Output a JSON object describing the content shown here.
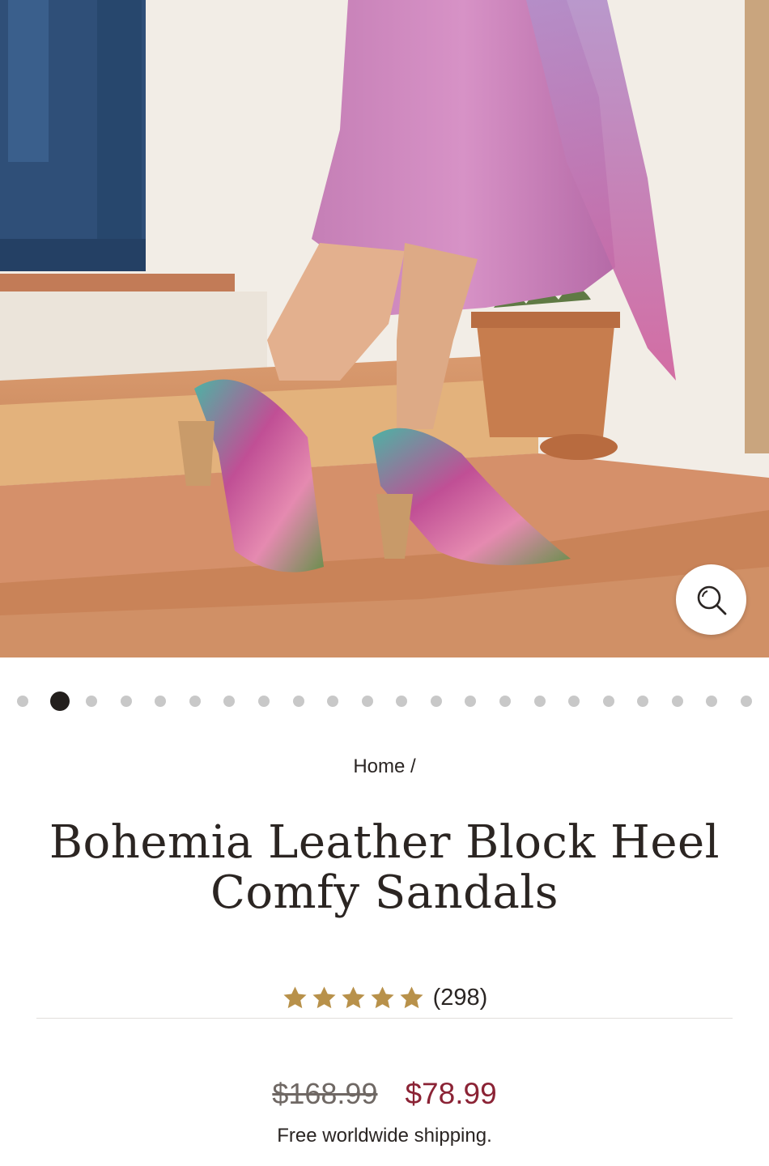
{
  "gallery": {
    "image_alt": "Woman in a pink satin skirt wearing multicolor floral leather block heel sandals on terracotta steps",
    "zoom_icon": "search-icon",
    "slide_count": 22,
    "active_slide": 2
  },
  "breadcrumb": {
    "home_label": "Home",
    "separator": "/"
  },
  "product": {
    "title": "Bohemia Leather Block Heel Comfy Sandals",
    "rating": 5,
    "review_count": "(298)",
    "price_original": "$168.99",
    "price_sale": "$78.99",
    "shipping": "Free worldwide shipping."
  },
  "colors": {
    "star": "#b8914a",
    "sale_price": "#8b2335",
    "active_dot": "#231f1d",
    "inactive_dot": "#c8c8c8"
  }
}
